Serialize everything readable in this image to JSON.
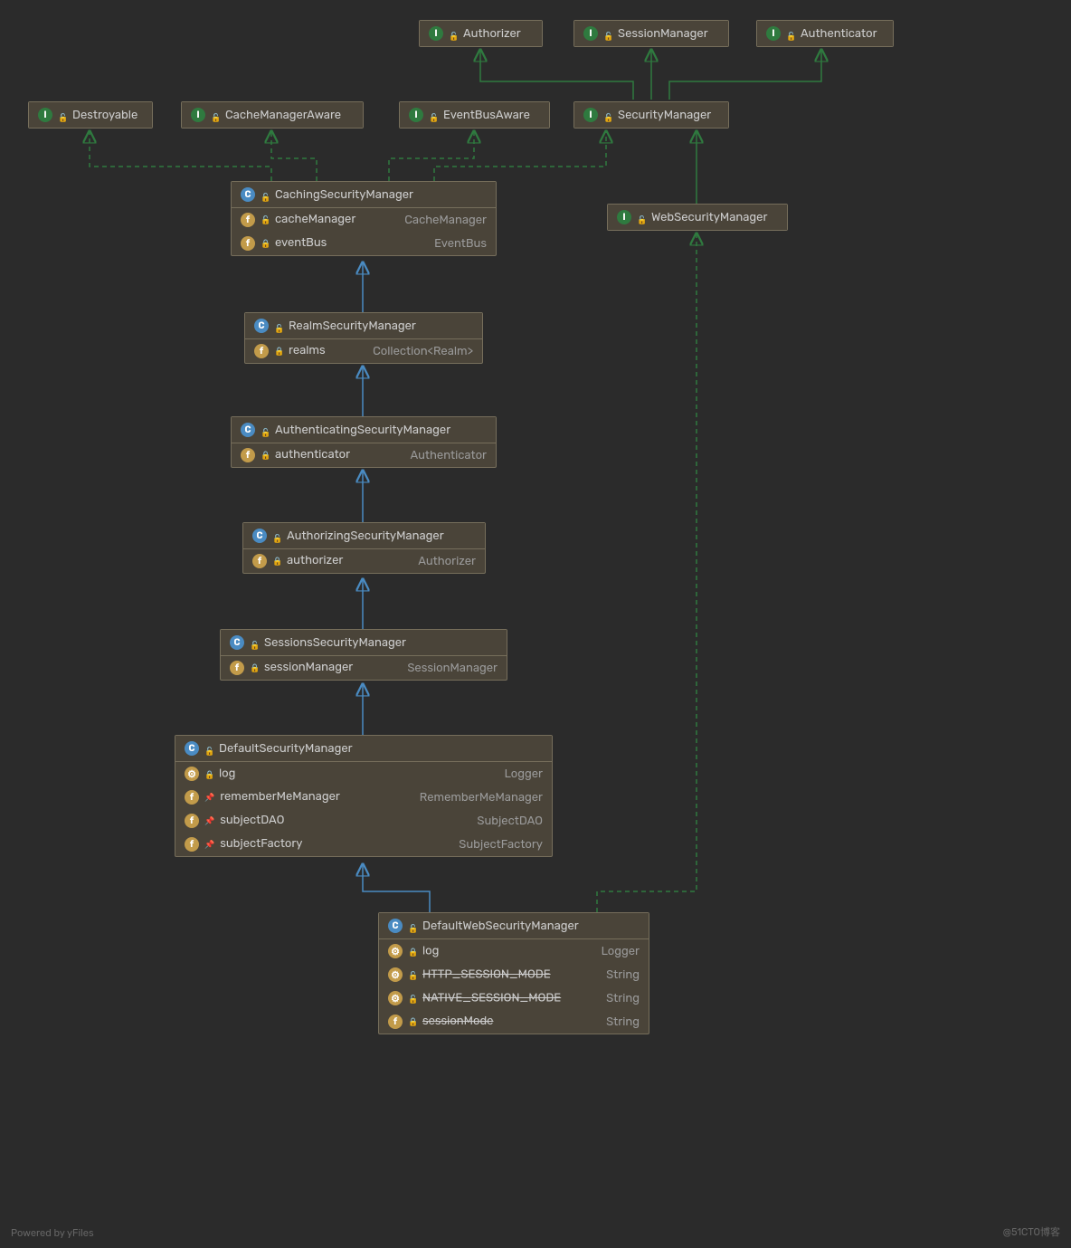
{
  "nodes": {
    "authorizer": {
      "name": "Authorizer"
    },
    "sessionManager": {
      "name": "SessionManager"
    },
    "authenticator": {
      "name": "Authenticator"
    },
    "destroyable": {
      "name": "Destroyable"
    },
    "cacheManagerAware": {
      "name": "CacheManagerAware"
    },
    "eventBusAware": {
      "name": "EventBusAware"
    },
    "securityManager": {
      "name": "SecurityManager"
    },
    "cachingSecurityManager": {
      "name": "CachingSecurityManager",
      "fields": [
        {
          "name": "cacheManager",
          "type": "CacheManager",
          "lock": "open"
        },
        {
          "name": "eventBus",
          "type": "EventBus",
          "lock": "closed"
        }
      ]
    },
    "webSecurityManager": {
      "name": "WebSecurityManager"
    },
    "realmSecurityManager": {
      "name": "RealmSecurityManager",
      "fields": [
        {
          "name": "realms",
          "type": "Collection<Realm>",
          "lock": "closed"
        }
      ]
    },
    "authenticatingSecurityManager": {
      "name": "AuthenticatingSecurityManager",
      "fields": [
        {
          "name": "authenticator",
          "type": "Authenticator",
          "lock": "closed"
        }
      ]
    },
    "authorizingSecurityManager": {
      "name": "AuthorizingSecurityManager",
      "fields": [
        {
          "name": "authorizer",
          "type": "Authorizer",
          "lock": "closed"
        }
      ]
    },
    "sessionsSecurityManager": {
      "name": "SessionsSecurityManager",
      "fields": [
        {
          "name": "sessionManager",
          "type": "SessionManager",
          "lock": "closed"
        }
      ]
    },
    "defaultSecurityManager": {
      "name": "DefaultSecurityManager",
      "fields": [
        {
          "name": "log",
          "type": "Logger",
          "icon": "m",
          "lock": "closed"
        },
        {
          "name": "rememberMeManager",
          "type": "RememberMeManager",
          "icon": "f",
          "lock": "pin"
        },
        {
          "name": "subjectDAO",
          "type": "SubjectDAO",
          "icon": "f",
          "lock": "pin"
        },
        {
          "name": "subjectFactory",
          "type": "SubjectFactory",
          "icon": "f",
          "lock": "pin"
        }
      ]
    },
    "defaultWebSecurityManager": {
      "name": "DefaultWebSecurityManager",
      "fields": [
        {
          "name": "log",
          "type": "Logger",
          "icon": "m",
          "lock": "closed"
        },
        {
          "name": "HTTP_SESSION_MODE",
          "type": "String",
          "icon": "m",
          "lock": "open",
          "strike": true
        },
        {
          "name": "NATIVE_SESSION_MODE",
          "type": "String",
          "icon": "m",
          "lock": "open",
          "strike": true
        },
        {
          "name": "sessionMode",
          "type": "String",
          "icon": "f",
          "lock": "closed",
          "strike": true
        }
      ]
    }
  },
  "footer": {
    "left": "Powered by yFiles",
    "right": "@51CTO博客"
  },
  "colors": {
    "bg": "#2b2b2b",
    "node": "#4a4439",
    "border": "#766e5b",
    "inherit": "#4a8bc2",
    "implement": "#2f7a3f"
  }
}
